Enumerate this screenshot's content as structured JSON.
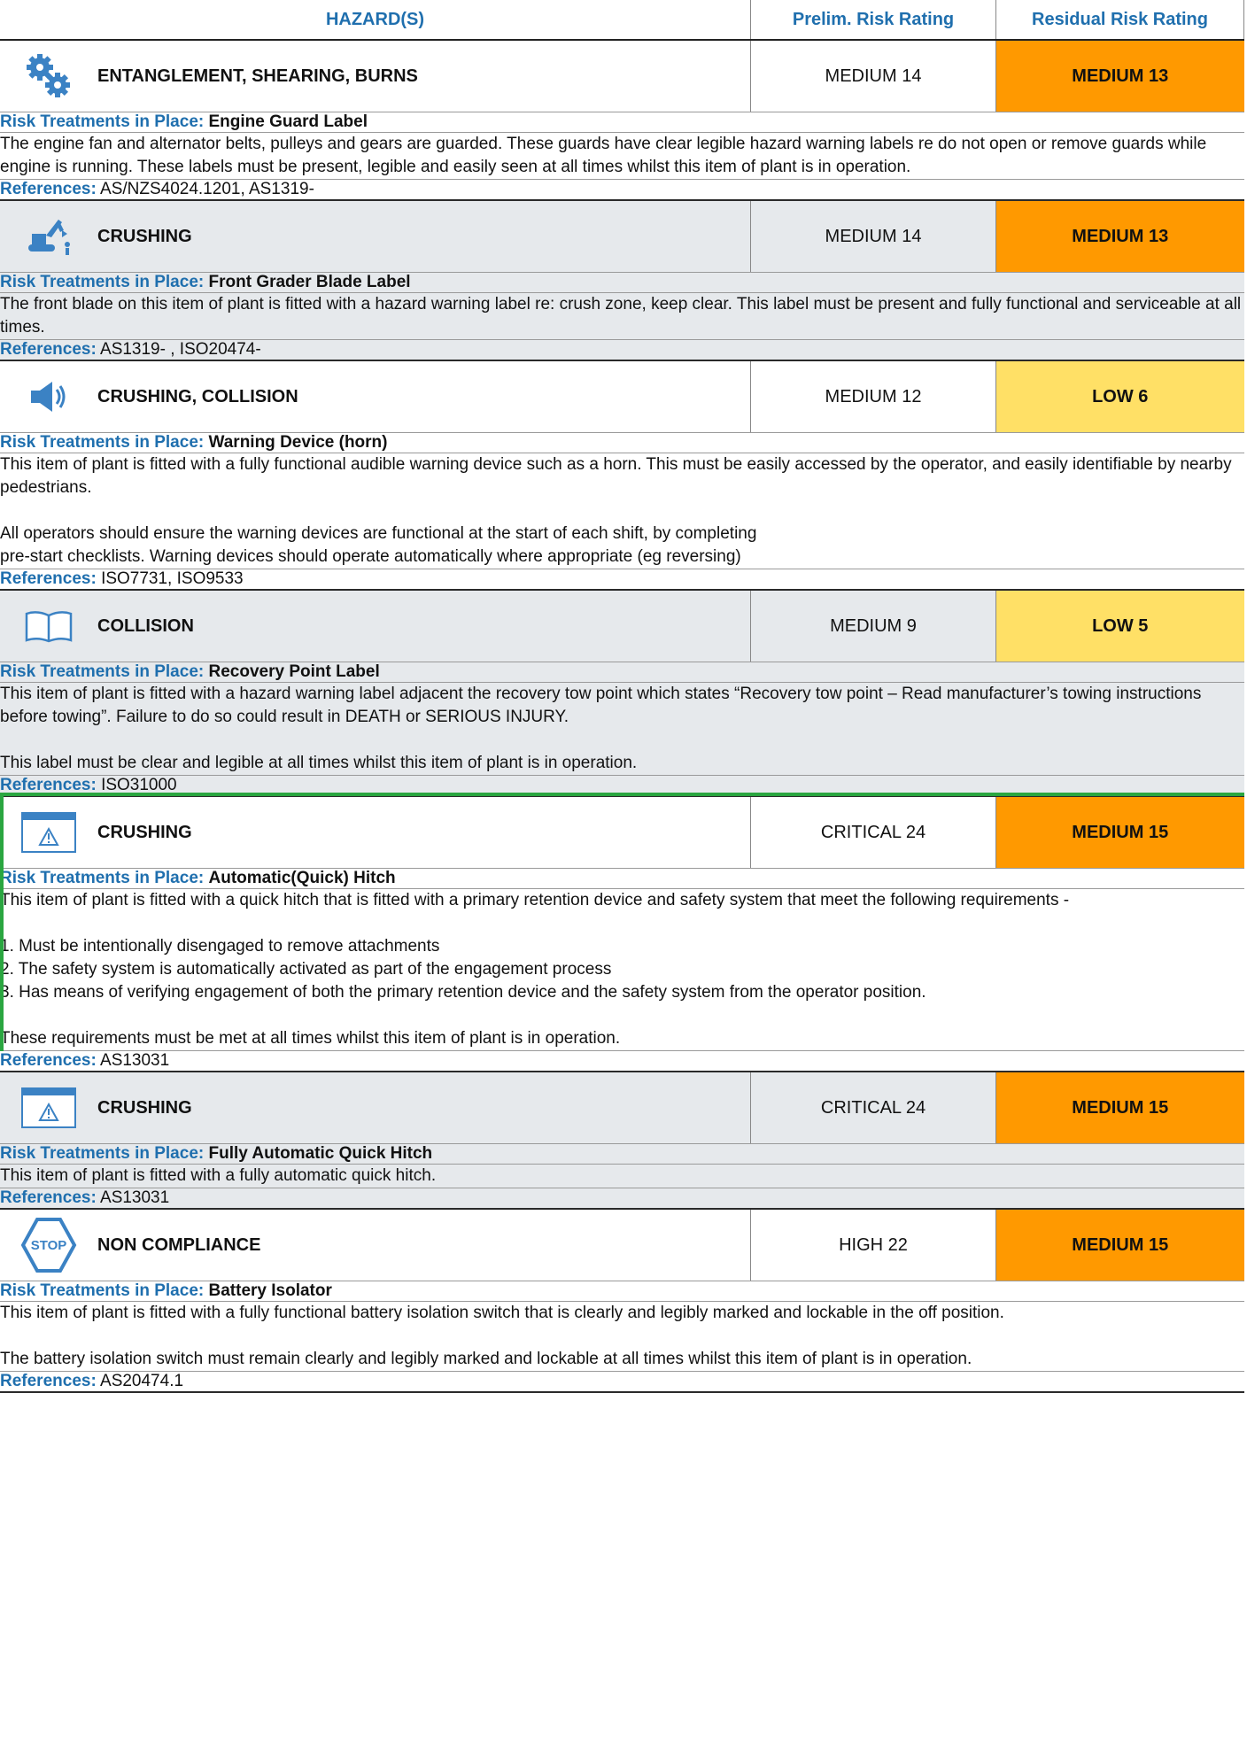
{
  "header": {
    "hazards": "HAZARD(S)",
    "prelim": "Prelim. Risk Rating",
    "residual": "Residual Risk Rating"
  },
  "labels": {
    "treatments": "Risk Treatments in Place:",
    "references": "References:"
  },
  "sections": [
    {
      "icon": "gears-icon",
      "hazard": "ENTANGLEMENT, SHEARING, BURNS",
      "prelim": "MEDIUM 14",
      "residual": "MEDIUM 13",
      "residual_color": "#ff9900",
      "treatment": "Engine Guard Label",
      "body": [
        "The engine fan and alternator belts, pulleys and gears are guarded. These guards have clear legible hazard warning labels re do not open or remove guards while engine is running. These labels must be present, legible and easily seen at all times whilst this item of plant is in operation."
      ],
      "references": "AS/NZS4024.1201, AS1319-"
    },
    {
      "icon": "excavator-icon",
      "hazard": "CRUSHING",
      "prelim": "MEDIUM 14",
      "residual": "MEDIUM 13",
      "residual_color": "#ff9900",
      "treatment": "Front Grader Blade Label",
      "body": [
        "The front blade on this item of plant is fitted with a hazard warning label re: crush zone, keep clear. This label must be present and fully functional and serviceable at all times."
      ],
      "references": "AS1319- , ISO20474-"
    },
    {
      "icon": "speaker-icon",
      "hazard": "CRUSHING, COLLISION",
      "prelim": "MEDIUM 12",
      "residual": "LOW 6",
      "residual_color": "#ffe066",
      "treatment": "Warning Device (horn)",
      "body": [
        "This item of plant is fitted with a fully functional audible warning device such as a horn. This must be easily accessed by the operator, and easily identifiable by nearby pedestrians.",
        "All operators should ensure the warning devices are functional at the start of each shift, by completing\npre-start checklists. Warning devices should operate automatically where appropriate (eg reversing)"
      ],
      "references": "ISO7731, ISO9533"
    },
    {
      "icon": "book-icon",
      "hazard": "COLLISION",
      "prelim": "MEDIUM 9",
      "residual": "LOW 5",
      "residual_color": "#ffe066",
      "treatment": "Recovery Point Label",
      "body": [
        "This item of plant is fitted with a hazard warning label adjacent the recovery tow point which states “Recovery tow point – Read manufacturer’s towing instructions before towing”. Failure to do so could result in DEATH or SERIOUS INJURY.",
        "This label must be clear and legible at all times whilst this item of plant is in operation."
      ],
      "references": "ISO31000"
    },
    {
      "icon": "warning-window-icon",
      "hazard": "CRUSHING",
      "prelim": "CRITICAL 24",
      "residual": "MEDIUM 15",
      "residual_color": "#ff9900",
      "treatment": "Automatic(Quick) Hitch",
      "body": [
        "This item of plant is fitted with a quick hitch that is fitted with a primary retention device and safety system that meet the following requirements -",
        "1. Must be intentionally disengaged to remove attachments\n2. The safety system is automatically activated as part of the engagement process\n3. Has means of verifying engagement of both the primary retention device and the safety system from the operator position.",
        "These requirements must be met at all times whilst this item of plant is in operation."
      ],
      "references": "AS13031"
    },
    {
      "icon": "warning-window-icon",
      "hazard": "CRUSHING",
      "prelim": "CRITICAL 24",
      "residual": "MEDIUM 15",
      "residual_color": "#ff9900",
      "treatment": "Fully Automatic Quick Hitch",
      "body": [
        "This item of plant is fitted with a fully automatic quick hitch."
      ],
      "references": "AS13031"
    },
    {
      "icon": "stop-sign-icon",
      "icon_text": "STOP",
      "hazard": "NON COMPLIANCE",
      "prelim": "HIGH 22",
      "residual": "MEDIUM 15",
      "residual_color": "#ff9900",
      "treatment": "Battery Isolator",
      "body": [
        "This item of plant is fitted with a fully functional battery isolation switch that is clearly and legibly marked and lockable in the off position.",
        "The battery isolation switch must remain clearly and legibly marked and lockable at all times whilst this item of plant is in operation."
      ],
      "references": "AS20474.1"
    }
  ]
}
